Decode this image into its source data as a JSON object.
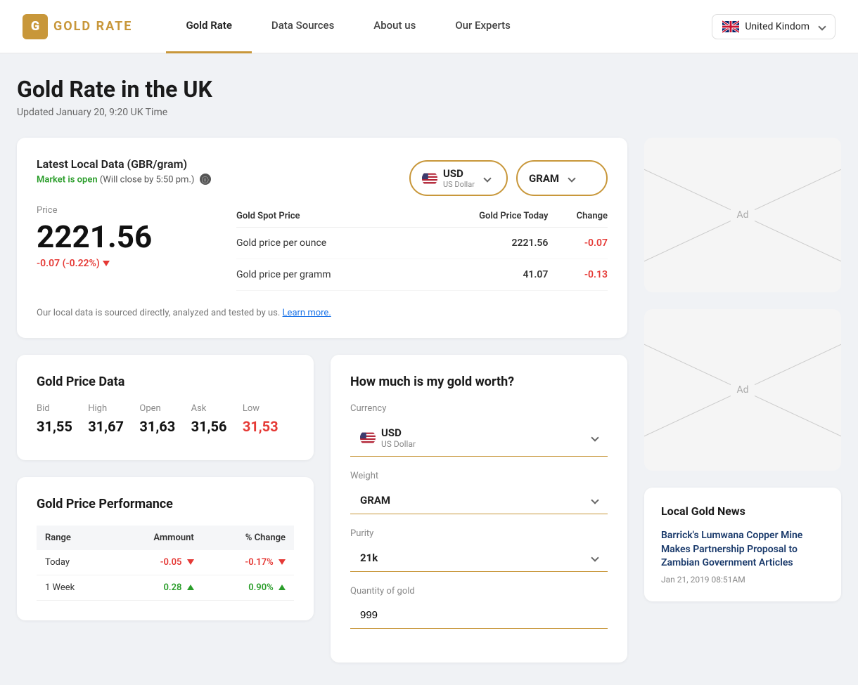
{
  "nav": {
    "logo_letter": "G",
    "logo_text_part1": "GOLD",
    "logo_text_part2": "RATE",
    "links": [
      {
        "label": "Gold Rate",
        "active": true
      },
      {
        "label": "Data Sources",
        "active": false
      },
      {
        "label": "About us",
        "active": false
      },
      {
        "label": "Our Experts",
        "active": false
      }
    ],
    "country": "United Kindom",
    "country_chevron": "▾"
  },
  "header": {
    "title": "Gold Rate in the UK",
    "subtitle": "Updated January 20, 9:20 UK Time"
  },
  "latest_data": {
    "title": "Latest Local Data (GBR/gram)",
    "market_open": "Market is open",
    "market_close": "(Will close by 5:50 pm.)",
    "currency": {
      "code": "USD",
      "name": "US Dollar"
    },
    "unit": "GRAM",
    "price_label": "Price",
    "price": "2221.56",
    "change": "-0.07 (-0.22%)",
    "table": {
      "headers": [
        "Gold Spot Price",
        "Gold Price Today",
        "Change"
      ],
      "rows": [
        {
          "label": "Gold price per ounce",
          "today": "2221.56",
          "change": "-0.07"
        },
        {
          "label": "Gold price per gramm",
          "today": "41.07",
          "change": "-0.13"
        }
      ]
    },
    "source_note": "Our local data is sourced directly, analyzed and tested by us.",
    "learn_more": "Learn more."
  },
  "gold_price_data": {
    "title": "Gold Price Data",
    "metrics": [
      {
        "label": "Bid",
        "value": "31,55"
      },
      {
        "label": "High",
        "value": "31,67"
      },
      {
        "label": "Open",
        "value": "31,63"
      },
      {
        "label": "Ask",
        "value": "31,56"
      },
      {
        "label": "Low",
        "value": "31,53",
        "red": true
      }
    ]
  },
  "performance": {
    "title": "Gold Price Performance",
    "headers": [
      "Range",
      "Ammount",
      "% Change"
    ],
    "rows": [
      {
        "range": "Today",
        "amount": "-0.05",
        "amount_dir": "neg",
        "pct": "-0.17%",
        "pct_dir": "neg"
      },
      {
        "range": "1 Week",
        "amount": "0.28",
        "amount_dir": "pos",
        "pct": "0.90%",
        "pct_dir": "pos"
      }
    ]
  },
  "calculator": {
    "title": "How much is my gold worth?",
    "currency_label": "Currency",
    "currency_code": "USD",
    "currency_name": "US Dollar",
    "weight_label": "Weight",
    "weight_value": "GRAM",
    "purity_label": "Purity",
    "purity_value": "21k",
    "quantity_label": "Quantity of gold",
    "quantity_value": "999"
  },
  "ads": {
    "label1": "Ad",
    "label2": "Ad"
  },
  "news": {
    "title": "Local Gold News",
    "items": [
      {
        "title": "Barrick's Lumwana Copper Mine Makes Partnership Proposal to Zambian Government Articles",
        "date": "Jan 21, 2019 08:51AM"
      }
    ]
  }
}
